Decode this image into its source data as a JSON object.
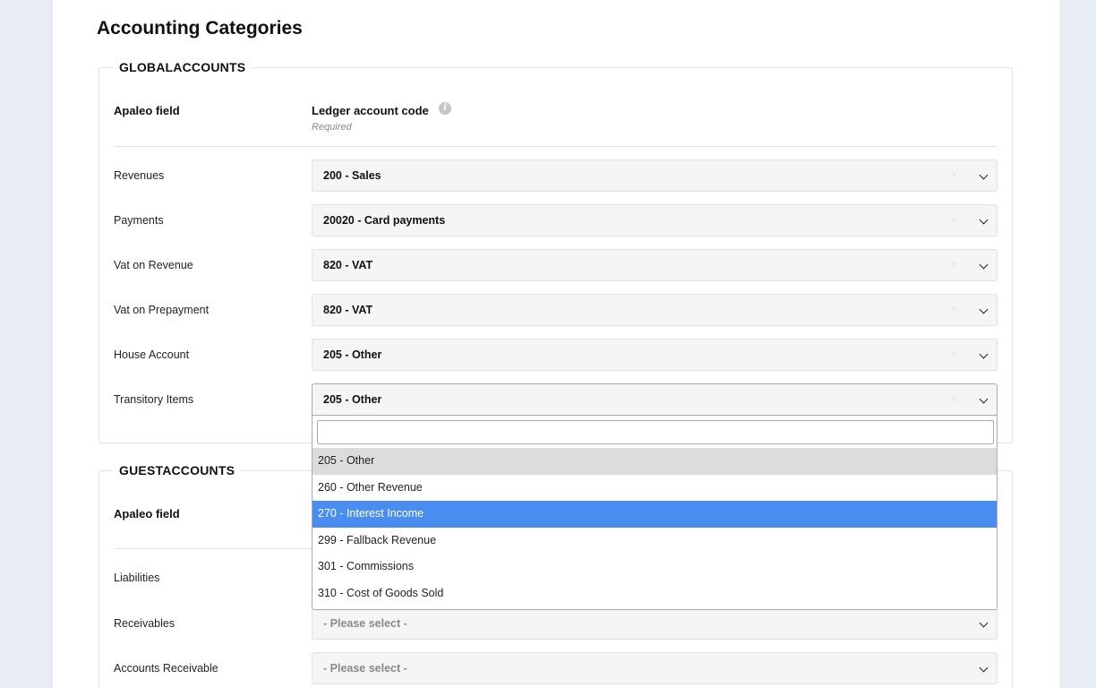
{
  "page": {
    "title": "Accounting Categories"
  },
  "global": {
    "legend": "GLOBALACCOUNTS",
    "col_field": "Apaleo field",
    "col_code": "Ledger account code",
    "col_code_note": "Required",
    "info_glyph": "i",
    "rows": [
      {
        "label": "Revenues",
        "value": "200 - Sales"
      },
      {
        "label": "Payments",
        "value": "20020 - Card payments"
      },
      {
        "label": "Vat on Revenue",
        "value": "820 - VAT"
      },
      {
        "label": "Vat on Prepayment",
        "value": "820 - VAT"
      },
      {
        "label": "House Account",
        "value": "205 - Other"
      },
      {
        "label": "Transitory Items",
        "value": "205 - Other"
      }
    ]
  },
  "guest": {
    "legend": "GUESTACCOUNTS",
    "col_field": "Apaleo field",
    "rows": [
      {
        "label": "Liabilities",
        "value": ""
      },
      {
        "label": "Receivables",
        "value": "- Please select -"
      },
      {
        "label": "Accounts Receivable",
        "value": "- Please select -"
      }
    ]
  },
  "clear_glyph": "×",
  "dropdown": {
    "search_value": "",
    "options": [
      "205 - Other",
      "260 - Other Revenue",
      "270 - Interest Income",
      "299 - Fallback Revenue",
      "301 - Commissions",
      "310 - Cost of Goods Sold"
    ],
    "highlighted": "205 - Other",
    "hovered": "270 - Interest Income"
  },
  "colors": {
    "accent": "#4a8df0",
    "background": "#e8ecf5"
  }
}
